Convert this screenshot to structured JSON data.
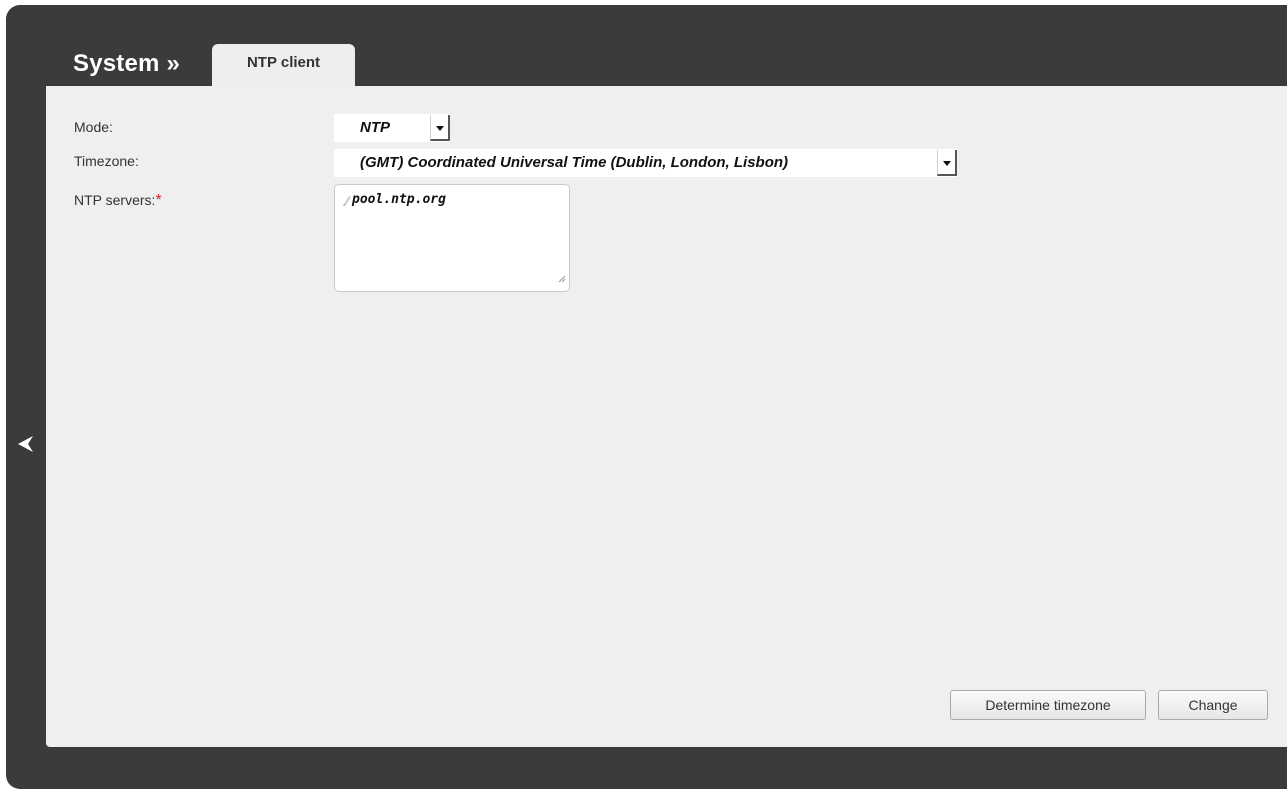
{
  "header": {
    "section_title": "System »",
    "active_tab": "NTP client"
  },
  "form": {
    "mode": {
      "label": "Mode:",
      "value": "NTP"
    },
    "timezone": {
      "label": "Timezone:",
      "value": "(GMT) Coordinated Universal Time (Dublin, London, Lisbon)"
    },
    "ntp_servers": {
      "label": "NTP servers:",
      "required_mark": "*",
      "value": "pool.ntp.org"
    }
  },
  "actions": {
    "determine_timezone": "Determine timezone",
    "change": "Change"
  },
  "icons": {
    "back": "chevron-left-icon",
    "dropdown": "triangle-down-icon",
    "edit": "pencil-icon",
    "resize": "resize-grip-icon"
  },
  "colors": {
    "frame": "#3b3b3b",
    "panel": "#efefef",
    "required": "#e02020"
  }
}
